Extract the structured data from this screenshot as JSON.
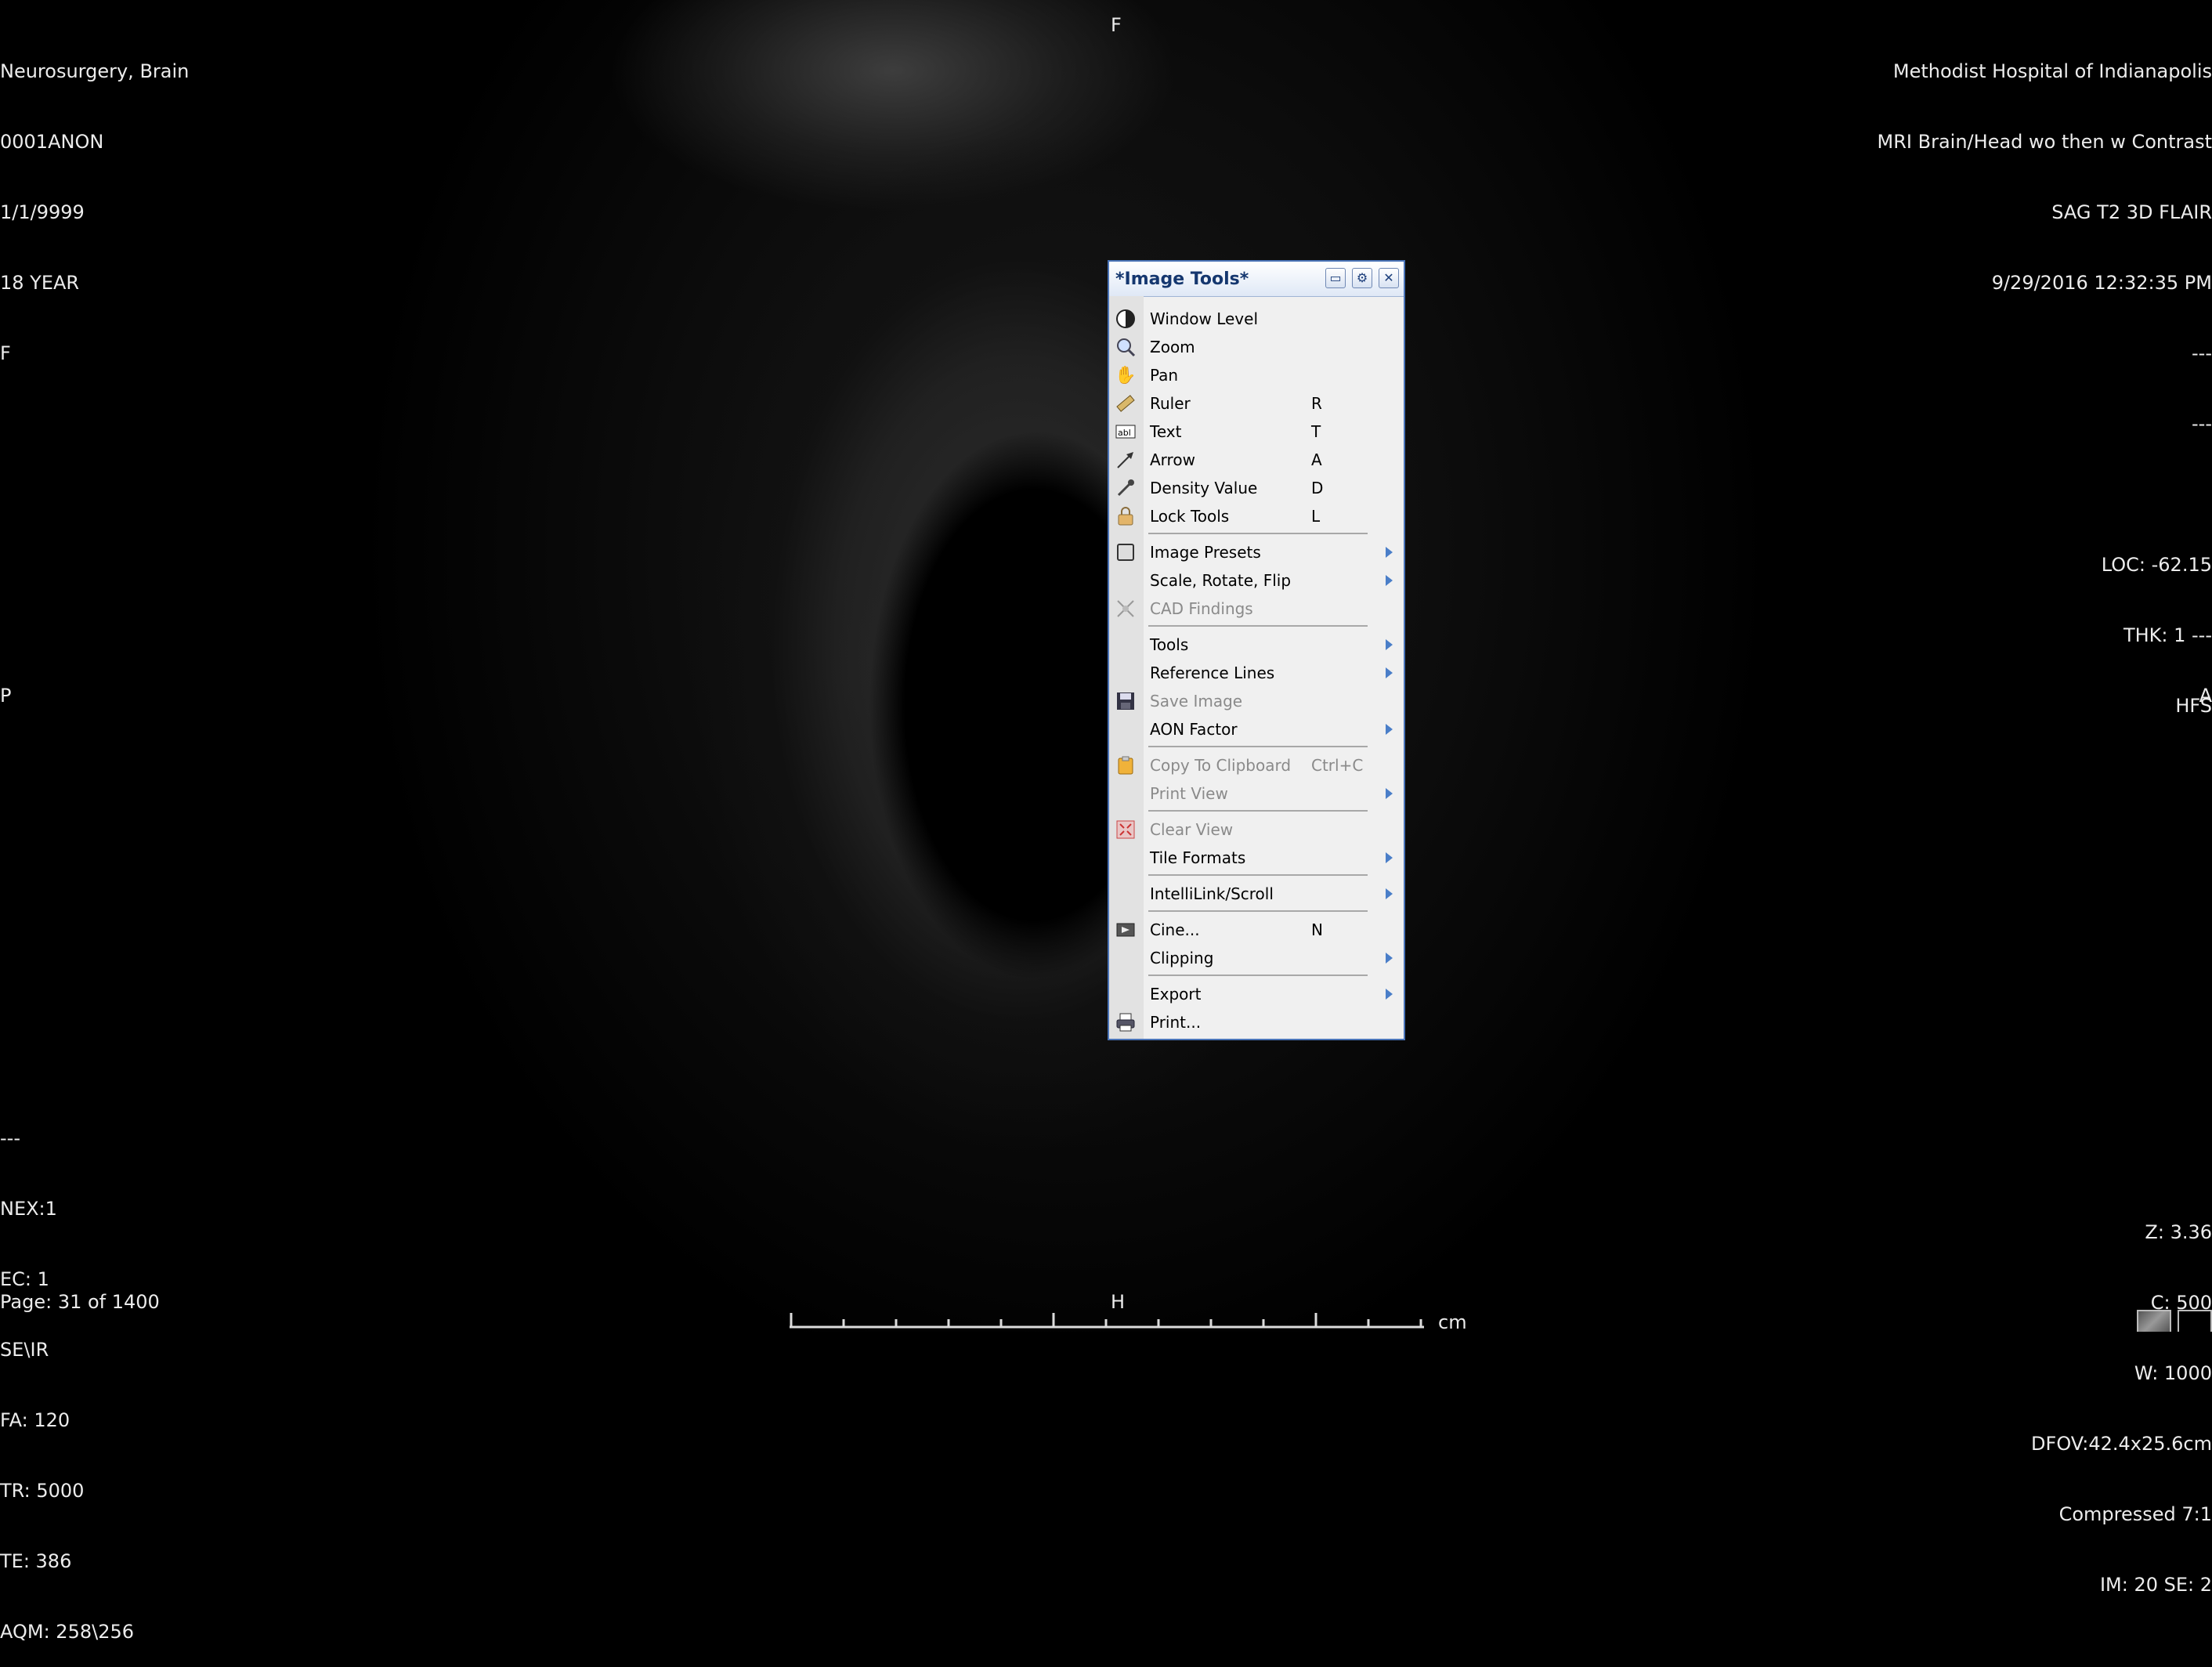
{
  "overlay": {
    "top_left": [
      "Neurosurgery, Brain",
      "0001ANON",
      "1/1/9999",
      "18 YEAR",
      "F"
    ],
    "top_right": [
      "Methodist Hospital of Indianapolis",
      "MRI Brain/Head wo then w Contrast",
      "SAG T2 3D FLAIR",
      "9/29/2016 12:32:35 PM",
      "---",
      "---",
      "",
      "LOC: -62.15",
      "THK: 1 ---",
      "HFS"
    ],
    "bottom_left": [
      "---",
      "NEX:1",
      "EC: 1",
      "SE\\IR",
      "FA: 120",
      "TR: 5000",
      "TE: 386",
      "AQM: 258\\256"
    ],
    "bottom_right": [
      "Z: 3.36",
      "C: 500",
      "W: 1000",
      "DFOV:42.4x25.6cm",
      "Compressed 7:1",
      "IM: 20 SE: 2"
    ],
    "orient_top": "F",
    "orient_left": "P",
    "orient_right": "A",
    "orient_bottom": "H",
    "page": "Page: 31 of 1400",
    "scale_unit": "cm"
  },
  "menu": {
    "title": "*Image Tools*",
    "items": [
      {
        "label": "Window Level",
        "key": "",
        "icon": "contrast-icon",
        "submenu": false,
        "disabled": false
      },
      {
        "label": "Zoom",
        "key": "",
        "icon": "magnifier-icon",
        "submenu": false,
        "disabled": false
      },
      {
        "label": "Pan",
        "key": "",
        "icon": "hand-icon",
        "submenu": false,
        "disabled": false
      },
      {
        "label": "Ruler",
        "key": "R",
        "icon": "ruler-icon",
        "submenu": false,
        "disabled": false
      },
      {
        "label": "Text",
        "key": "T",
        "icon": "text-icon",
        "submenu": false,
        "disabled": false
      },
      {
        "label": "Arrow",
        "key": "A",
        "icon": "arrow-icon",
        "submenu": false,
        "disabled": false
      },
      {
        "label": "Density Value",
        "key": "D",
        "icon": "dropper-icon",
        "submenu": false,
        "disabled": false
      },
      {
        "label": "Lock Tools",
        "key": "L",
        "icon": "lock-icon",
        "submenu": false,
        "disabled": false
      },
      {
        "label": "Image Presets",
        "key": "",
        "icon": "preset-icon",
        "submenu": true,
        "disabled": false
      },
      {
        "label": "Scale, Rotate, Flip",
        "key": "",
        "icon": "",
        "submenu": true,
        "disabled": false
      },
      {
        "label": "CAD Findings",
        "key": "",
        "icon": "cad-icon",
        "submenu": false,
        "disabled": true
      },
      {
        "label": "Tools",
        "key": "",
        "icon": "",
        "submenu": true,
        "disabled": false
      },
      {
        "label": "Reference Lines",
        "key": "",
        "icon": "",
        "submenu": true,
        "disabled": false
      },
      {
        "label": "Save Image",
        "key": "",
        "icon": "floppy-icon",
        "submenu": false,
        "disabled": true
      },
      {
        "label": "AON Factor",
        "key": "",
        "icon": "",
        "submenu": true,
        "disabled": false
      },
      {
        "label": "Copy To Clipboard",
        "key": "Ctrl+C",
        "icon": "clipboard-icon",
        "submenu": false,
        "disabled": true
      },
      {
        "label": "Print View",
        "key": "",
        "icon": "",
        "submenu": true,
        "disabled": true
      },
      {
        "label": "Clear View",
        "key": "",
        "icon": "clear-view-icon",
        "submenu": false,
        "disabled": true
      },
      {
        "label": "Tile Formats",
        "key": "",
        "icon": "",
        "submenu": true,
        "disabled": false
      },
      {
        "label": "IntelliLink/Scroll",
        "key": "",
        "icon": "",
        "submenu": true,
        "disabled": false
      },
      {
        "label": "Cine...",
        "key": "N",
        "icon": "film-icon",
        "submenu": false,
        "disabled": false
      },
      {
        "label": "Clipping",
        "key": "",
        "icon": "",
        "submenu": true,
        "disabled": false
      },
      {
        "label": "Export",
        "key": "",
        "icon": "",
        "submenu": true,
        "disabled": false
      },
      {
        "label": "Print...",
        "key": "",
        "icon": "printer-icon",
        "submenu": false,
        "disabled": false
      }
    ]
  }
}
